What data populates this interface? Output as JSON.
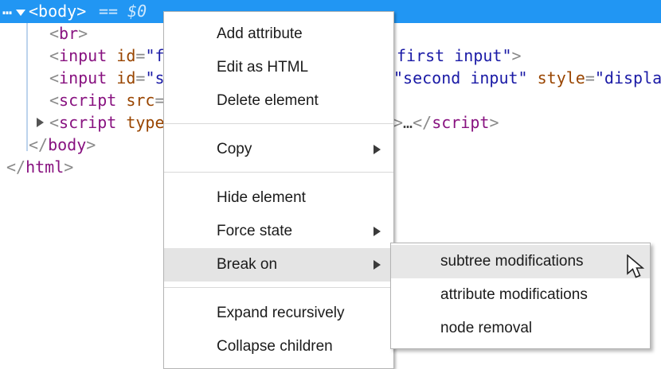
{
  "inspector": {
    "selected_node": {
      "ellipsis": "…",
      "tag": "<body>",
      "hint": "== $0"
    },
    "rows": {
      "br": {
        "open": "<",
        "name": "br",
        "close": ">"
      },
      "input1_left": {
        "open": "<",
        "name": "input",
        "attr": " id",
        "eq": "=",
        "value": "\"f"
      },
      "input1_right": {
        "value": "first input\"",
        "close": ">"
      },
      "input2_left": {
        "open": "<",
        "name": "input",
        "attr": " id",
        "eq": "=",
        "value": "\"s"
      },
      "input2_right": {
        "value1": "\"second input\"",
        "attr": " style",
        "eq": "=",
        "value2": "\"display"
      },
      "script1_left": {
        "open": "<",
        "name": "script",
        "attr": " src",
        "eq": "="
      },
      "script2_left": {
        "open": "<",
        "name": "script",
        "attr": " type"
      },
      "script2_right": {
        "bracket": ">",
        "ellipsis": "…",
        "open": "</",
        "name": "script",
        "close": ">"
      },
      "body_close": {
        "open": "</",
        "name": "body",
        "close": ">"
      },
      "html_close": {
        "open": "</",
        "name": "html",
        "close": ">"
      }
    }
  },
  "context_menu": {
    "items": [
      {
        "label": "Add attribute"
      },
      {
        "label": "Edit as HTML"
      },
      {
        "label": "Delete element"
      },
      {
        "label": "Copy",
        "has_submenu": true
      },
      {
        "label": "Hide element"
      },
      {
        "label": "Force state",
        "has_submenu": true
      },
      {
        "label": "Break on",
        "has_submenu": true,
        "highlighted": true
      },
      {
        "label": "Expand recursively"
      },
      {
        "label": "Collapse children"
      }
    ]
  },
  "submenu": {
    "items": [
      {
        "label": "subtree modifications",
        "highlighted": true
      },
      {
        "label": "attribute modifications"
      },
      {
        "label": "node removal"
      }
    ]
  },
  "icons": {
    "submenu_arrow": "triangle-right",
    "selected_caret": "triangle-down",
    "collapsed_caret": "triangle-right",
    "pointer": "arrow-cursor"
  },
  "colors": {
    "selection_blue": "#2196f3",
    "tag_purple": "#881280",
    "attr_orange": "#994500",
    "value_navy": "#1a1aa6",
    "menu_highlight": "#e4e4e4"
  }
}
